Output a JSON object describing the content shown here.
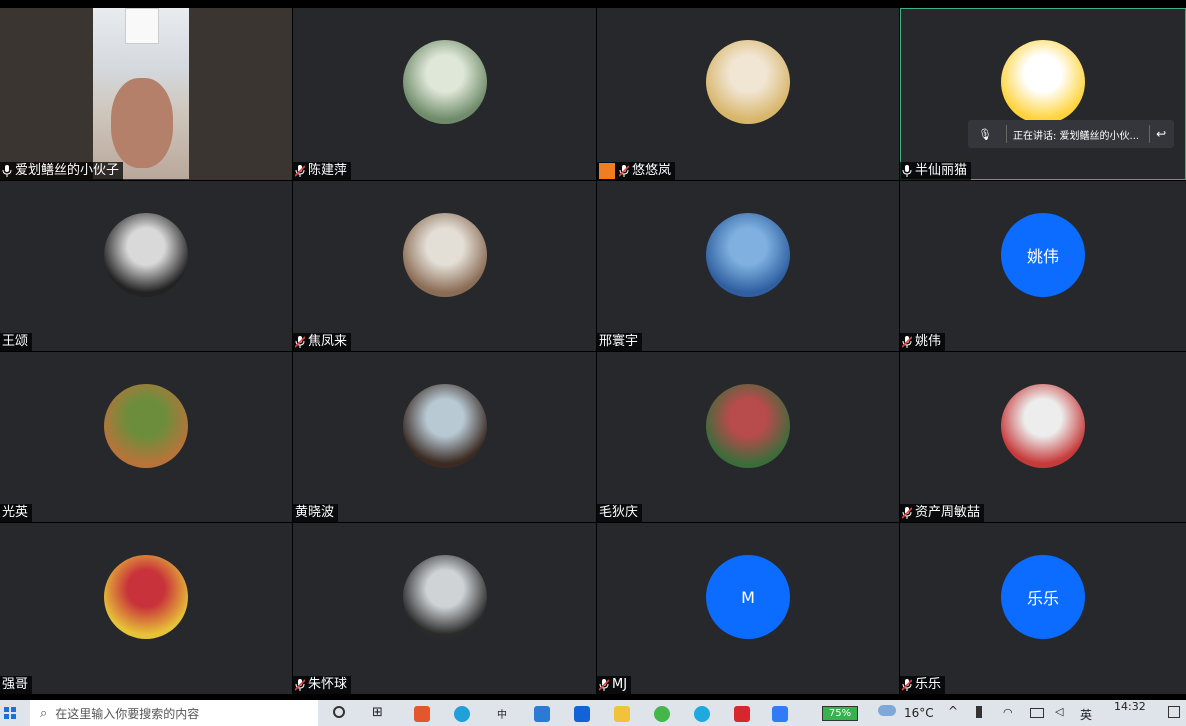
{
  "meeting": {
    "tiles": [
      {
        "name": "爱划鳝丝的小伙子",
        "mic": "active",
        "type": "camera",
        "colors": [
          "#3a3530",
          "#b4806a"
        ]
      },
      {
        "name": "陈建萍",
        "mic": "muted",
        "type": "photo",
        "colors": [
          "#6f8c6a",
          "#dfe7d8"
        ]
      },
      {
        "name": "悠悠岚",
        "mic": "muted",
        "type": "photo",
        "colors": [
          "#d8b66b",
          "#f1e5d3"
        ],
        "badge": "host-icon"
      },
      {
        "name": "半仙丽猫",
        "mic": "active",
        "type": "photo",
        "colors": [
          "#ffd33b",
          "#ffffff"
        ]
      },
      {
        "name": "王颂",
        "mic": "none",
        "type": "photo",
        "colors": [
          "#222222",
          "#d9d9d9"
        ]
      },
      {
        "name": "焦凤来",
        "mic": "muted",
        "type": "photo",
        "colors": [
          "#8b6d55",
          "#e3ded6"
        ]
      },
      {
        "name": "邢寰宇",
        "mic": "none",
        "type": "photo",
        "colors": [
          "#2f5fa0",
          "#7fb0e0"
        ]
      },
      {
        "name": "姚伟",
        "mic": "muted",
        "type": "letter",
        "letter": "姚伟"
      },
      {
        "name": "光英",
        "mic": "none",
        "type": "photo",
        "colors": [
          "#b7743a",
          "#6c8e3c"
        ]
      },
      {
        "name": "黄晓波",
        "mic": "none",
        "type": "photo",
        "colors": [
          "#3a2a22",
          "#b8c9d4"
        ]
      },
      {
        "name": "毛狄庆",
        "mic": "none",
        "type": "photo",
        "colors": [
          "#3d6c3b",
          "#b84b4b"
        ]
      },
      {
        "name": "资产周敏喆",
        "mic": "muted",
        "type": "photo",
        "colors": [
          "#c63a3a",
          "#ededed"
        ]
      },
      {
        "name": "强哥",
        "mic": "none",
        "type": "photo",
        "colors": [
          "#e8c239",
          "#c8323a"
        ]
      },
      {
        "name": "朱怀球",
        "mic": "muted",
        "type": "photo",
        "colors": [
          "#2a2a2a",
          "#cfd3d6"
        ]
      },
      {
        "name": "MJ",
        "mic": "muted",
        "type": "letter",
        "letter": "M"
      },
      {
        "name": "乐乐",
        "mic": "muted",
        "type": "letter",
        "letter": "乐乐"
      }
    ],
    "speaking_label": "正在讲话: 爱划鳝丝的小伙..."
  },
  "taskbar": {
    "search_placeholder": "在这里输入你要搜索的内容",
    "ime": "中",
    "battery": "75%",
    "weather": "16°C",
    "lang": "英",
    "time": "14:32"
  },
  "colors": {
    "tile_bg": "#26282c",
    "accent": "#0b6cff",
    "speaking": "#3fb37f",
    "taskbar": "#dfe4ea"
  }
}
